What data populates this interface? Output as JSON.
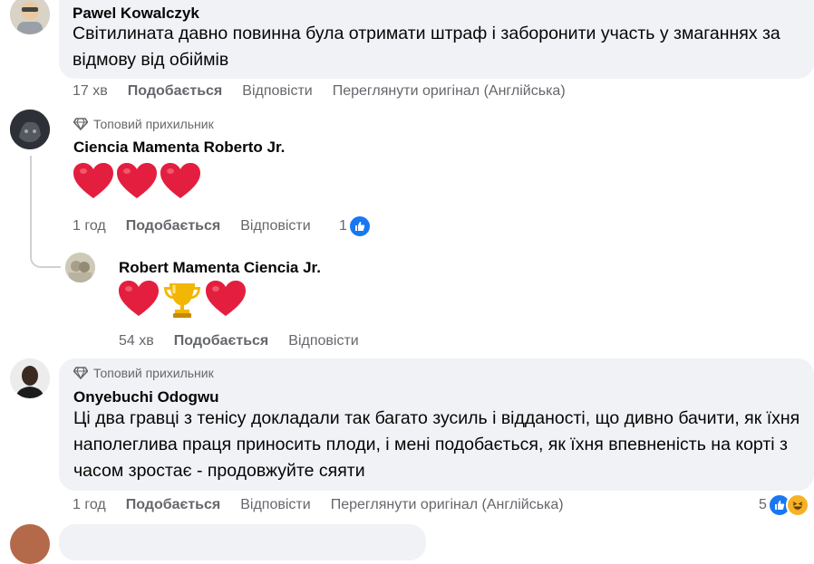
{
  "comments": [
    {
      "author": "Pawel Kowalczyk",
      "text": "Світилината давно повинна була отримати штраф і заборонити участь у змаганнях за відмову від обіймів",
      "time": "17 хв",
      "like_label": "Подобається",
      "reply_label": "Відповісти",
      "translate_label": "Переглянути оригінал (Англійська)"
    },
    {
      "badge": "Топовий прихильник",
      "author": "Ciencia Mamenta Roberto Jr.",
      "emoji": [
        "heart",
        "heart",
        "heart"
      ],
      "time": "1 год",
      "like_label": "Подобається",
      "reply_label": "Відповісти",
      "reactions_count": "1",
      "reaction_icons": [
        "like-icon"
      ]
    },
    {
      "author": "Robert Mamenta Ciencia Jr.",
      "emoji": [
        "heart",
        "trophy",
        "heart"
      ],
      "time": "54 хв",
      "like_label": "Подобається",
      "reply_label": "Відповісти"
    },
    {
      "badge": "Топовий прихильник",
      "author": "Onyebuchi Odogwu",
      "text": "Ці два гравці з тенісу докладали так багато зусиль і відданості, що дивно бачити, як їхня наполеглива праця приносить плоди, і мені подобається, як їхня впевненість на корті з часом зростає - продовжуйте сяяти",
      "time": "1 год",
      "like_label": "Подобається",
      "reply_label": "Відповісти",
      "translate_label": "Переглянути оригінал (Англійська)",
      "reactions_count": "5",
      "reaction_icons": [
        "like-icon",
        "laughing-emoji-icon"
      ]
    }
  ],
  "colors": {
    "bubble": "#f0f2f5",
    "meta": "#65676b",
    "like_blue": "#1877f2",
    "heart_red": "#e41e3f"
  }
}
